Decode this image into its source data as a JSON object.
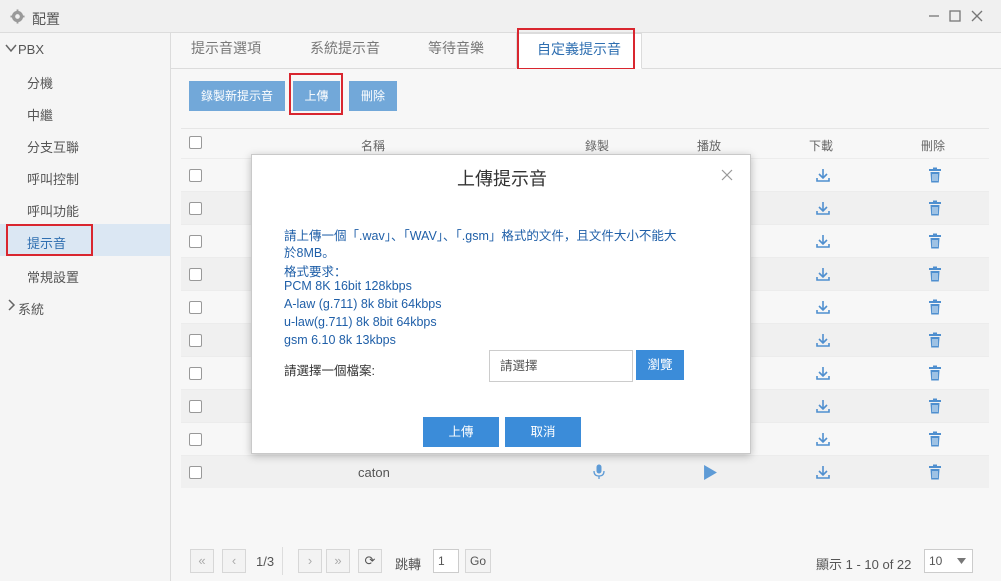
{
  "window": {
    "title": "配置"
  },
  "sidebar": {
    "groups": [
      {
        "label": "PBX"
      },
      {
        "label": "系統"
      }
    ],
    "items": [
      {
        "label": "分機"
      },
      {
        "label": "中繼"
      },
      {
        "label": "分支互聯"
      },
      {
        "label": "呼叫控制"
      },
      {
        "label": "呼叫功能"
      },
      {
        "label": "提示音"
      },
      {
        "label": "常規設置"
      }
    ]
  },
  "tabs": [
    {
      "label": "提示音選項"
    },
    {
      "label": "系統提示音"
    },
    {
      "label": "等待音樂"
    },
    {
      "label": "自定義提示音"
    }
  ],
  "toolbar": {
    "record_label": "錄製新提示音",
    "upload_label": "上傳",
    "delete_label": "刪除"
  },
  "table": {
    "columns": [
      "名稱",
      "錄製",
      "播放",
      "下載",
      "刪除"
    ],
    "last_row_name": "caton"
  },
  "pager": {
    "page_info": "1/3",
    "jump_label": "跳轉",
    "jump_value": "1",
    "go_label": "Go",
    "display_info": "顯示 1 - 10 of 22",
    "page_size": "10"
  },
  "modal": {
    "title": "上傳提示音",
    "info_line1": "請上傳一個「.wav」、「WAV」、「.gsm」格式的文件，且文件大小不能大",
    "info_line2": "於8MB。",
    "format_title": "格式要求：",
    "formats": [
      "PCM 8K 16bit 128kbps",
      "A-law  (g.711) 8k 8bit 64kbps",
      "u-law(g.711) 8k 8bit 64kbps",
      "gsm 6.10 8k 13kbps"
    ],
    "file_label": "請選擇一個檔案:",
    "file_placeholder": "請選擇",
    "browse_label": "瀏覽",
    "upload_label": "上傳",
    "cancel_label": "取消"
  },
  "colors": {
    "accent": "#3b8cd9",
    "light_button": "#72a8d9",
    "highlight": "#d9262f",
    "info_text": "#1f5fa8"
  }
}
